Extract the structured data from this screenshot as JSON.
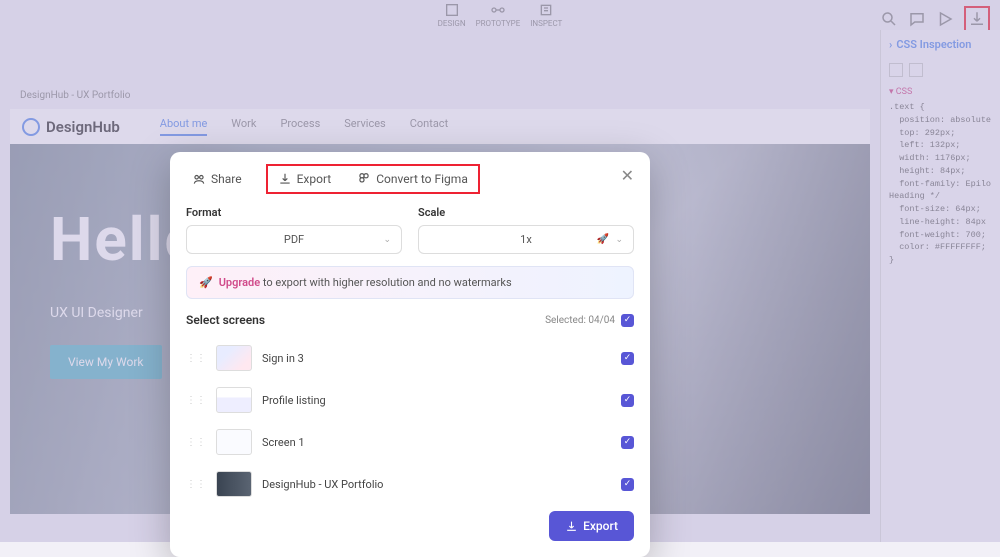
{
  "topbar": {
    "design": "DESIGN",
    "prototype": "PROTOTYPE",
    "inspect": "INSPECT"
  },
  "sidepanel": {
    "title": "CSS Inspection",
    "section": "▾ CSS",
    "code": ".text {\n  position: absolute\n  top: 292px;\n  left: 132px;\n  width: 1176px;\n  height: 84px;\n  font-family: Epilo\nHeading */\n  font-size: 64px;\n  line-height: 84px\n  font-weight: 700;\n  color: #FFFFFFFF;\n}"
  },
  "breadcrumb": "DesignHub - UX Portfolio",
  "site": {
    "name": "DesignHub",
    "nav": [
      "About me",
      "Work",
      "Process",
      "Services",
      "Contact"
    ],
    "hero_title": "Hello",
    "hero_sub": "UX UI Designer",
    "hero_btn": "View My Work"
  },
  "modal": {
    "tabs": {
      "share": "Share",
      "export": "Export",
      "figma": "Convert to Figma"
    },
    "format_label": "Format",
    "format_value": "PDF",
    "scale_label": "Scale",
    "scale_value": "1x",
    "upgrade_word": "Upgrade",
    "upgrade_rest": " to export with higher resolution and no watermarks",
    "select_label": "Select screens",
    "selected_text": "Selected: 04/04",
    "screens": [
      {
        "name": "Sign in 3"
      },
      {
        "name": "Profile listing"
      },
      {
        "name": "Screen 1"
      },
      {
        "name": "DesignHub - UX Portfolio"
      }
    ],
    "export_btn": "Export"
  }
}
